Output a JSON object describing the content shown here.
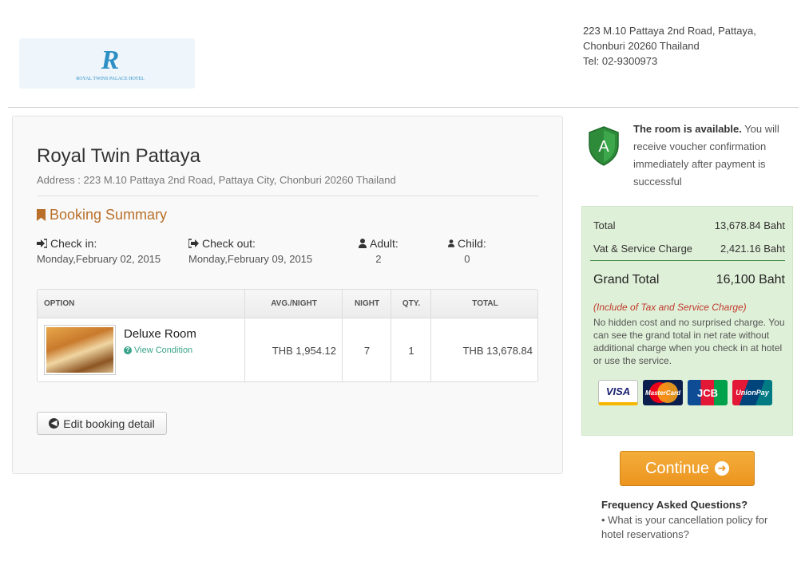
{
  "header": {
    "logo_icon": "royal-twins-logo",
    "logo_text": "ROYAL TWINS PALACE HOTEL",
    "address_line1": "223 M.10 Pattaya 2nd Road, Pattaya,",
    "address_line2": "Chonburi 20260 Thailand",
    "tel": "Tel: 02-9300973"
  },
  "hotel": {
    "name": "Royal Twin Pattaya",
    "address": "Address : 223 M.10 Pattaya 2nd Road, Pattaya City, Chonburi 20260 Thailand"
  },
  "summary": {
    "title": "Booking Summary",
    "check_in_label": "Check in:",
    "check_in_value": "Monday,February 02, 2015",
    "check_out_label": "Check out:",
    "check_out_value": "Monday,February 09, 2015",
    "adult_label": "Adult:",
    "adult_value": "2",
    "child_label": "Child:",
    "child_value": "0"
  },
  "table": {
    "headers": [
      "OPTION",
      "AVG./NIGHT",
      "NIGHT",
      "QTY.",
      "TOTAL"
    ],
    "row": {
      "room_name": "Deluxe Room",
      "view_condition": "View Condition",
      "avg_night": "THB 1,954.12",
      "night": "7",
      "qty": "1",
      "total": "THB 13,678.84"
    }
  },
  "edit_button": "Edit booking detail",
  "availability": {
    "bold": "The room is available.",
    "rest": " You will receive voucher confirmation immediately after payment is successful",
    "shield_letter": "A"
  },
  "pricing": {
    "total_label": "Total",
    "total_value": "13,678.84 Baht",
    "vat_label": "Vat & Service Charge",
    "vat_value": "2,421.16 Baht",
    "grand_label": "Grand Total",
    "grand_value": "16,100 Baht",
    "include_note": "(Include of Tax and Service Charge)",
    "hidden_note": "No hidden cost and no surprised charge. You can see the grand total in net rate without additional charge when you check in at hotel or use the service.",
    "cards": [
      "VISA",
      "MasterCard",
      "JCB",
      "UnionPay"
    ]
  },
  "continue_button": "Continue",
  "faq": {
    "title": "Frequency Asked Questions?",
    "link": "• What is your cancellation policy for hotel reservations?"
  },
  "colors": {
    "accent": "#b8702a",
    "price_box_bg": "#dff0d8",
    "continue_bg": "#eb951f",
    "link_green": "#3aa38a"
  }
}
